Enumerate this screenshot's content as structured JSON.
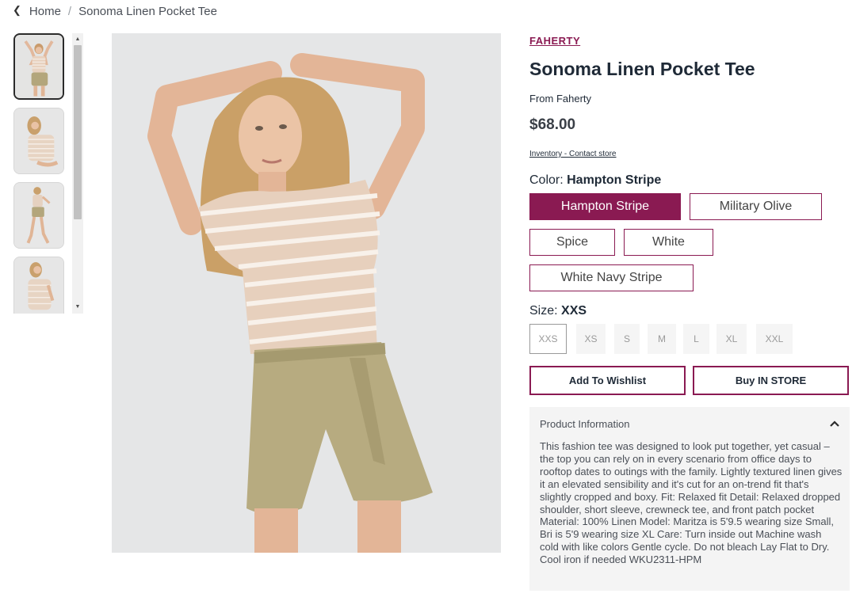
{
  "breadcrumb": {
    "home": "Home",
    "separator": "/",
    "current": "Sonoma Linen Pocket Tee"
  },
  "thumbnails": [
    {
      "label": "",
      "active": true
    },
    {
      "label": "",
      "active": false
    },
    {
      "label": "",
      "active": false
    },
    {
      "label": "",
      "active": false
    }
  ],
  "product": {
    "brand": "FAHERTY",
    "title": "Sonoma Linen Pocket Tee",
    "from": "From Faherty",
    "price": "$68.00",
    "inventory_link": "Inventory - Contact store"
  },
  "color": {
    "label": "Color: ",
    "selected": "Hampton Stripe",
    "options": [
      "Hampton Stripe",
      "Military Olive",
      "Spice",
      "White",
      "White Navy Stripe"
    ]
  },
  "size": {
    "label": "Size: ",
    "selected": "XXS",
    "options": [
      "XXS",
      "XS",
      "S",
      "M",
      "L",
      "XL",
      "XXL"
    ]
  },
  "actions": {
    "wishlist": "Add To Wishlist",
    "buy": "Buy IN STORE"
  },
  "info": {
    "heading": "Product Information",
    "body": "This fashion tee was designed to look put together, yet casual – the top you can rely on in every scenario from office days to rooftop dates to outings with the family. Lightly textured linen gives it an elevated sensibility and it's cut for an on-trend fit that's slightly cropped and boxy. Fit: Relaxed fit Detail: Relaxed dropped shoulder, short sleeve, crewneck tee, and front patch pocket Material: 100% Linen Model: Maritza is 5'9.5 wearing size Small, Bri is 5'9 wearing size XL Care: Turn inside out Machine wash cold with like colors Gentle cycle. Do not bleach Lay Flat to Dry. Cool iron if needed WKU2311-HPM"
  },
  "colors": {
    "accent": "#8a1a52",
    "text": "#1f2a37",
    "panel": "#f4f4f4"
  },
  "icons": {
    "breadcrumb_back": "chevron-left-icon",
    "accordion_toggle": "chevron-up-icon",
    "scroll_up": "triangle-up-icon",
    "scroll_down": "triangle-down-icon"
  }
}
